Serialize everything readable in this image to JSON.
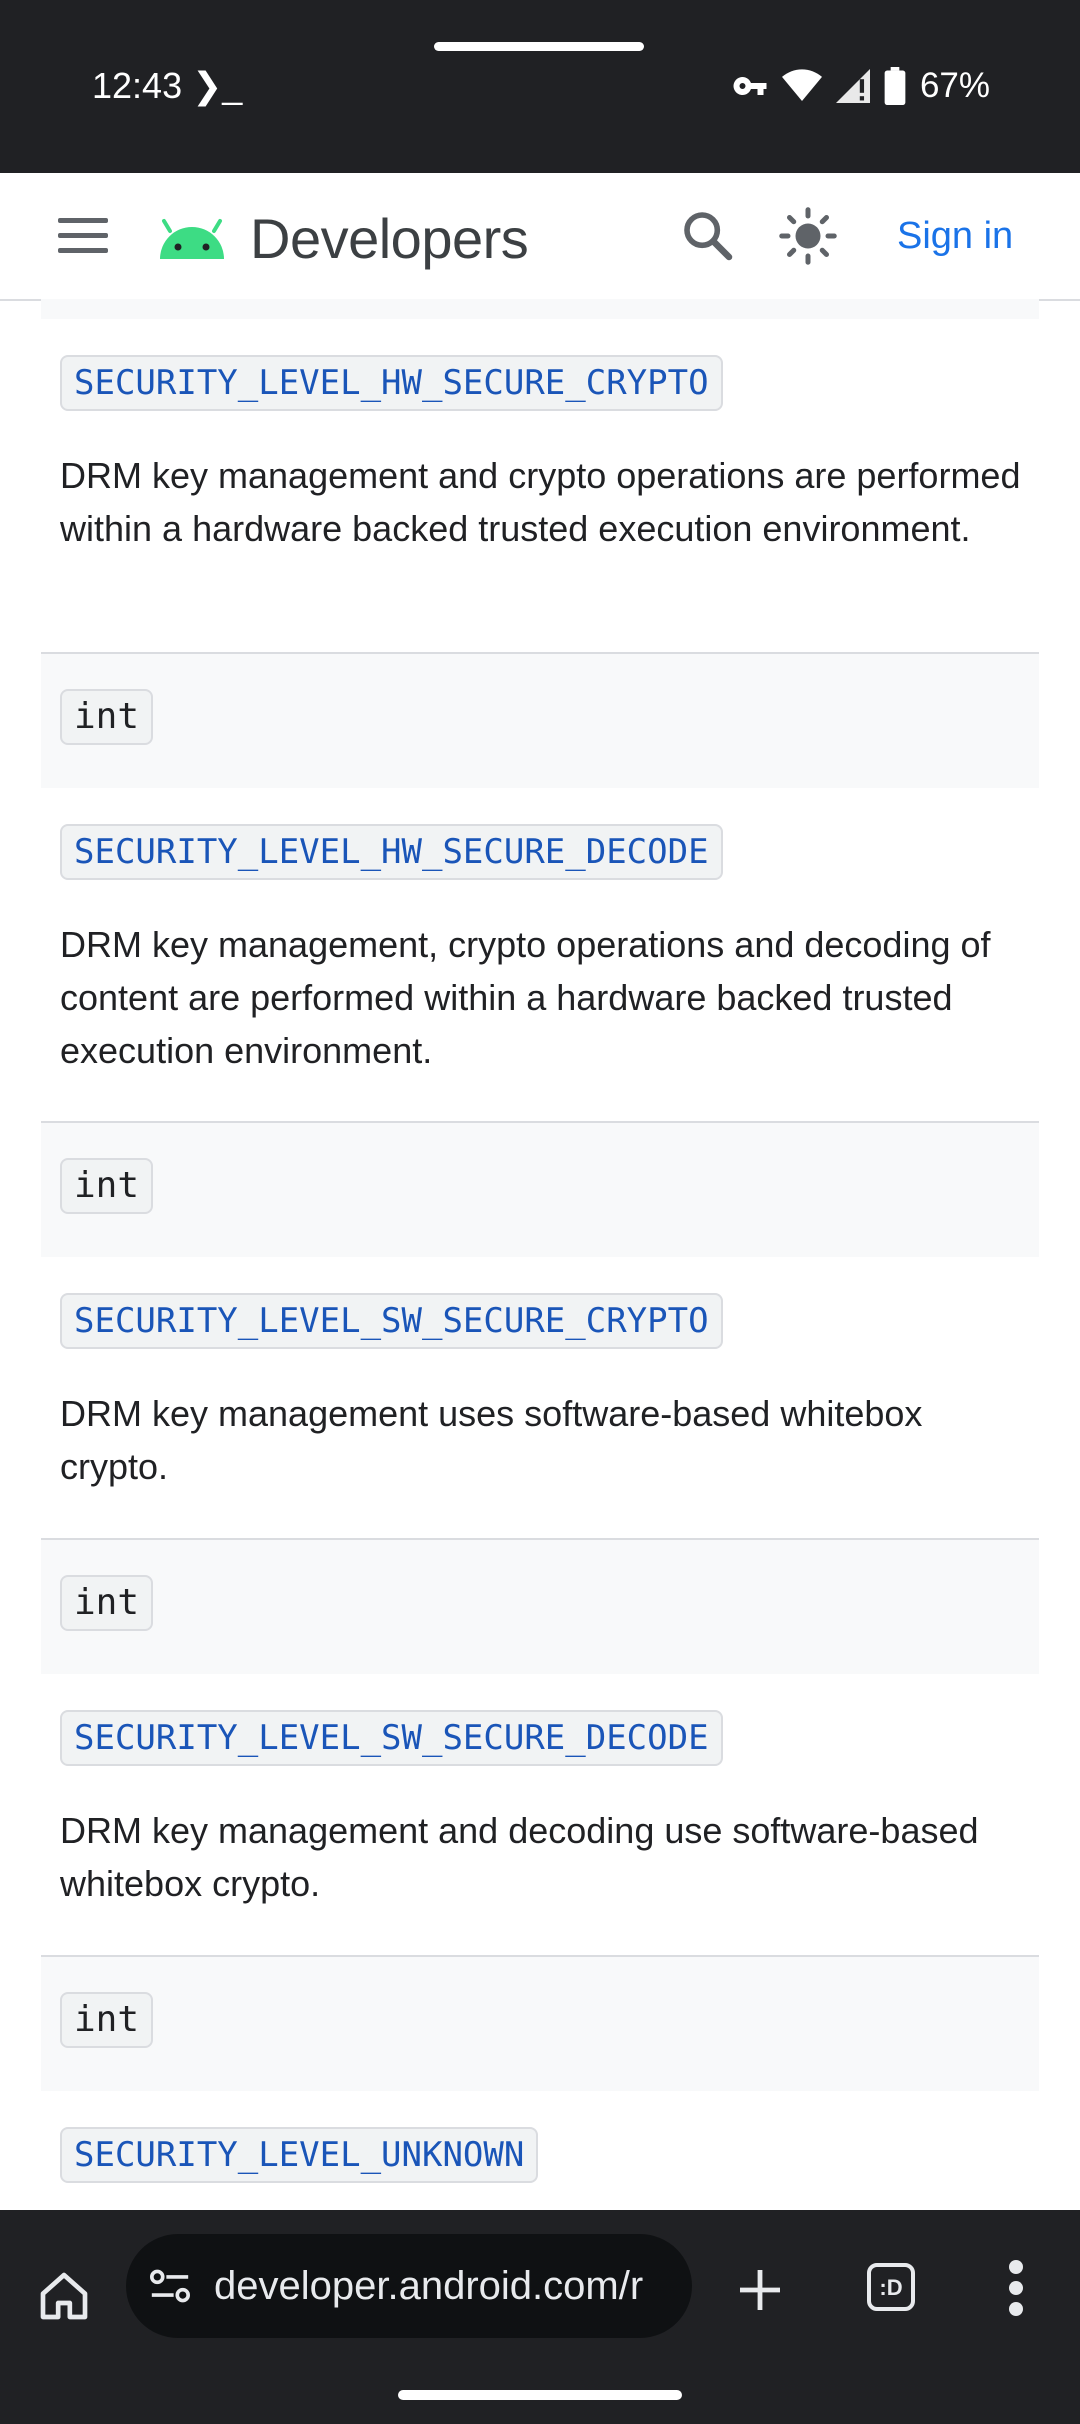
{
  "status_bar": {
    "time": "12:43",
    "terminal_glyph": "❯_",
    "battery": "67%"
  },
  "header": {
    "brand": "Developers",
    "sign_in": "Sign in"
  },
  "constants": [
    {
      "name": "SECURITY_LEVEL_HW_SECURE_CRYPTO",
      "description": "DRM key management and crypto operations are performed within a hardware backed trusted execution environment."
    },
    {
      "type": "int",
      "name": "SECURITY_LEVEL_HW_SECURE_DECODE",
      "description": "DRM key management, crypto operations and decoding of content are performed within a hardware backed trusted execution environment."
    },
    {
      "type": "int",
      "name": "SECURITY_LEVEL_SW_SECURE_CRYPTO",
      "description": "DRM key management uses software-based whitebox crypto."
    },
    {
      "type": "int",
      "name": "SECURITY_LEVEL_SW_SECURE_DECODE",
      "description": "DRM key management and decoding use software-based whitebox crypto."
    },
    {
      "type": "int",
      "name": "SECURITY_LEVEL_UNKNOWN"
    }
  ],
  "browser": {
    "url": "developer.android.com/r",
    "tabs_label": ":D"
  },
  "icons": {
    "menu": "hamburger-icon",
    "search": "search-icon",
    "theme": "brightness-icon",
    "home": "home-icon",
    "site_settings": "tune-icon",
    "new_tab": "plus-icon",
    "tabs": "tab-switcher-icon",
    "overflow": "more-vert-icon"
  },
  "colors": {
    "link_blue": "#1a73e8",
    "code_blue": "#1a55b8",
    "android_green": "#3ddc84",
    "status_bg": "#202124"
  }
}
